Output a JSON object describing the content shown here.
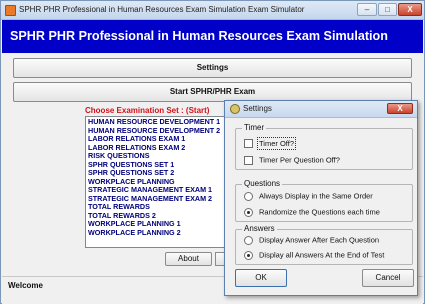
{
  "window": {
    "title": "SPHR PHR Professional in Human Resources Exam Simulation Exam Simulator",
    "minimize": "–",
    "maximize": "□",
    "close": "X"
  },
  "banner": {
    "title": "SPHR PHR Professional in Human Resources Exam Simulation"
  },
  "buttons": {
    "settings": "Settings",
    "start": "Start SPHR/PHR Exam",
    "about": "About"
  },
  "exam_sets": {
    "label": "Choose Examination Set : (Start)",
    "items": [
      "HUMAN RESOURCE DEVELOPMENT 1",
      "HUMAN RESOURCE DEVELOPMENT 2",
      "LABOR RELATIONS EXAM 1",
      "LABOR RELATIONS EXAM 2",
      "RISK QUESTIONS",
      "SPHR QUESTIONS SET 1",
      "SPHR QUESTIONS SET 2",
      "WORKPLACE PLANNING",
      "STRATEGIC MANAGEMENT EXAM 1",
      "STRATEGIC MANAGEMENT EXAM 2",
      "TOTAL REWARDS",
      "TOTAL REWARDS 2",
      "WORKPLACE PLANNING 1",
      "WORKPLACE PLANNING 2"
    ]
  },
  "status": {
    "text": "Welcome"
  },
  "settings_dialog": {
    "title": "Settings",
    "close": "X",
    "timer": {
      "title": "Timer",
      "timer_off": "Timer Off?",
      "timer_per_question_off": "Timer Per Question Off?"
    },
    "questions": {
      "title": "Questions",
      "same_order": "Always Display in the Same Order",
      "randomize": "Randomize the Questions each time",
      "selected": "randomize"
    },
    "answers": {
      "title": "Answers",
      "after_each": "Display Answer After Each Question",
      "at_end": "Display all Answers At the End of Test",
      "selected": "at_end"
    },
    "ok": "OK",
    "cancel": "Cancel"
  }
}
